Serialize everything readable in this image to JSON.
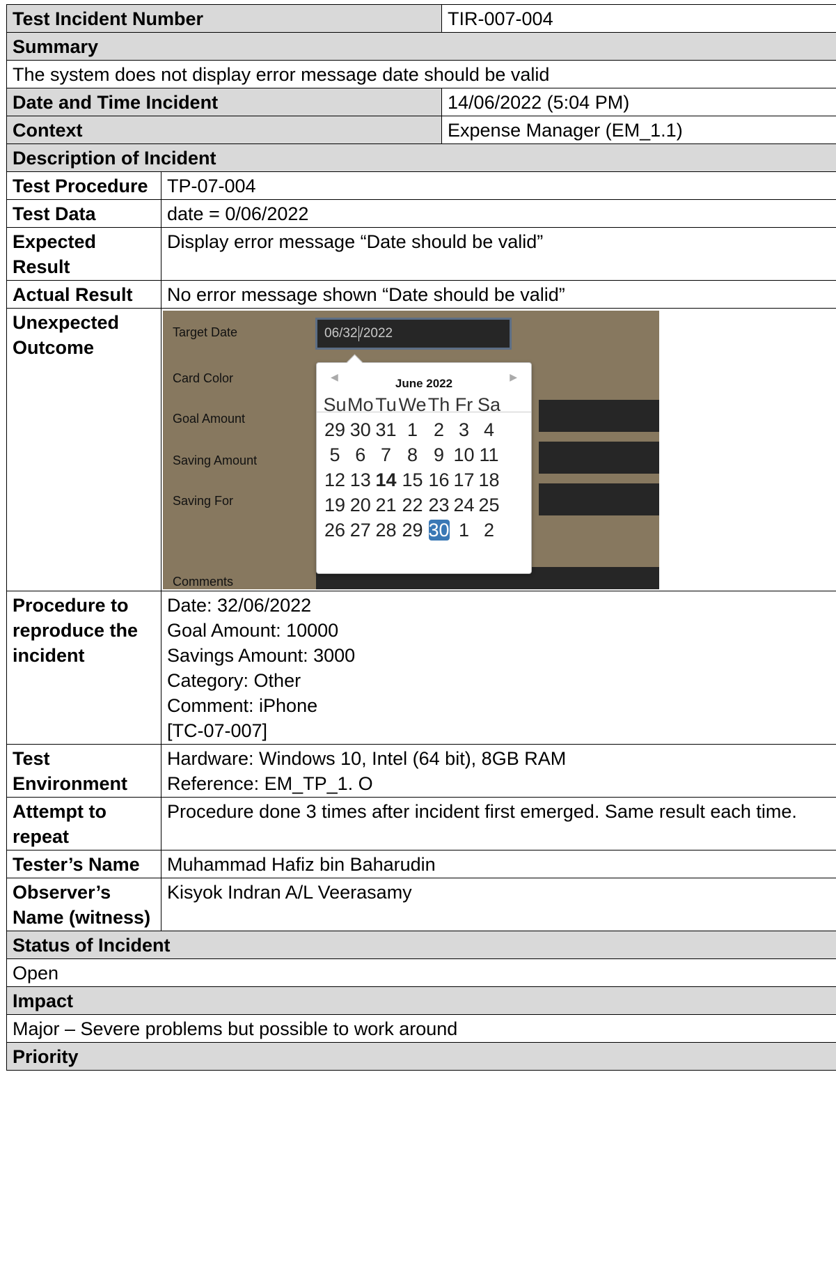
{
  "report": {
    "incident_number_label": "Test Incident Number",
    "incident_number_value": "TIR-007-004",
    "summary_heading": "Summary",
    "summary_text": "The system does not display error message date should be valid",
    "datetime_label": "Date and Time Incident",
    "datetime_value": "14/06/2022 (5:04 PM)",
    "context_label": "Context",
    "context_value": "Expense Manager (EM_1.1)",
    "description_heading": "Description of Incident",
    "test_procedure_label": "Test Procedure",
    "test_procedure_value": "TP-07-004",
    "test_data_label": "Test Data",
    "test_data_value": "date = 0/06/2022",
    "expected_label": "Expected Result",
    "expected_value": "Display error message “Date should be valid”",
    "actual_label": "Actual Result",
    "actual_value": "No error message shown “Date should be valid”",
    "unexpected_label": "Unexpected Outcome",
    "procedure_label": "Procedure to reproduce the incident",
    "procedure_lines": [
      "Date: 32/06/2022",
      "Goal Amount: 10000",
      "Savings Amount: 3000",
      "Category: Other",
      "Comment: iPhone",
      "[TC-07-007]"
    ],
    "environment_label": "Test Environment",
    "environment_lines": [
      "Hardware: Windows 10, Intel (64 bit), 8GB RAM",
      "Reference: EM_TP_1. O"
    ],
    "attempt_label": "Attempt to repeat",
    "attempt_value": "Procedure done 3 times after incident first emerged. Same result each time.",
    "tester_label": "Tester’s Name",
    "tester_value": "Muhammad Hafiz bin Baharudin",
    "observer_label": "Observer’s Name (witness)",
    "observer_value": "Kisyok Indran A/L Veerasamy",
    "status_heading": "Status of Incident",
    "status_value": "Open",
    "impact_heading": "Impact",
    "impact_value": "Major – Severe problems but possible to work around",
    "priority_heading": "Priority"
  },
  "screenshot": {
    "labels": {
      "target_date": "Target Date",
      "card_color": "Card Color",
      "goal_amount": "Goal Amount",
      "saving_amount": "Saving Amount",
      "saving_for": "Saving For",
      "comments": "Comments"
    },
    "date_input_before_caret": "06/32",
    "date_input_after_caret": "/2022",
    "calendar": {
      "month_title": "June 2022",
      "prev_icon": "left-triangle",
      "next_icon": "right-triangle",
      "weekdays": [
        "Su",
        "Mo",
        "Tu",
        "We",
        "Th",
        "Fr",
        "Sa"
      ],
      "weeks": [
        [
          "29",
          "30",
          "31",
          "1",
          "2",
          "3",
          "4"
        ],
        [
          "5",
          "6",
          "7",
          "8",
          "9",
          "10",
          "11"
        ],
        [
          "12",
          "13",
          "14",
          "15",
          "16",
          "17",
          "18"
        ],
        [
          "19",
          "20",
          "21",
          "22",
          "23",
          "24",
          "25"
        ],
        [
          "26",
          "27",
          "28",
          "29",
          "30",
          "1",
          "2"
        ]
      ],
      "today": "14",
      "selected": "30",
      "selected_color": "#3a78b5"
    }
  }
}
